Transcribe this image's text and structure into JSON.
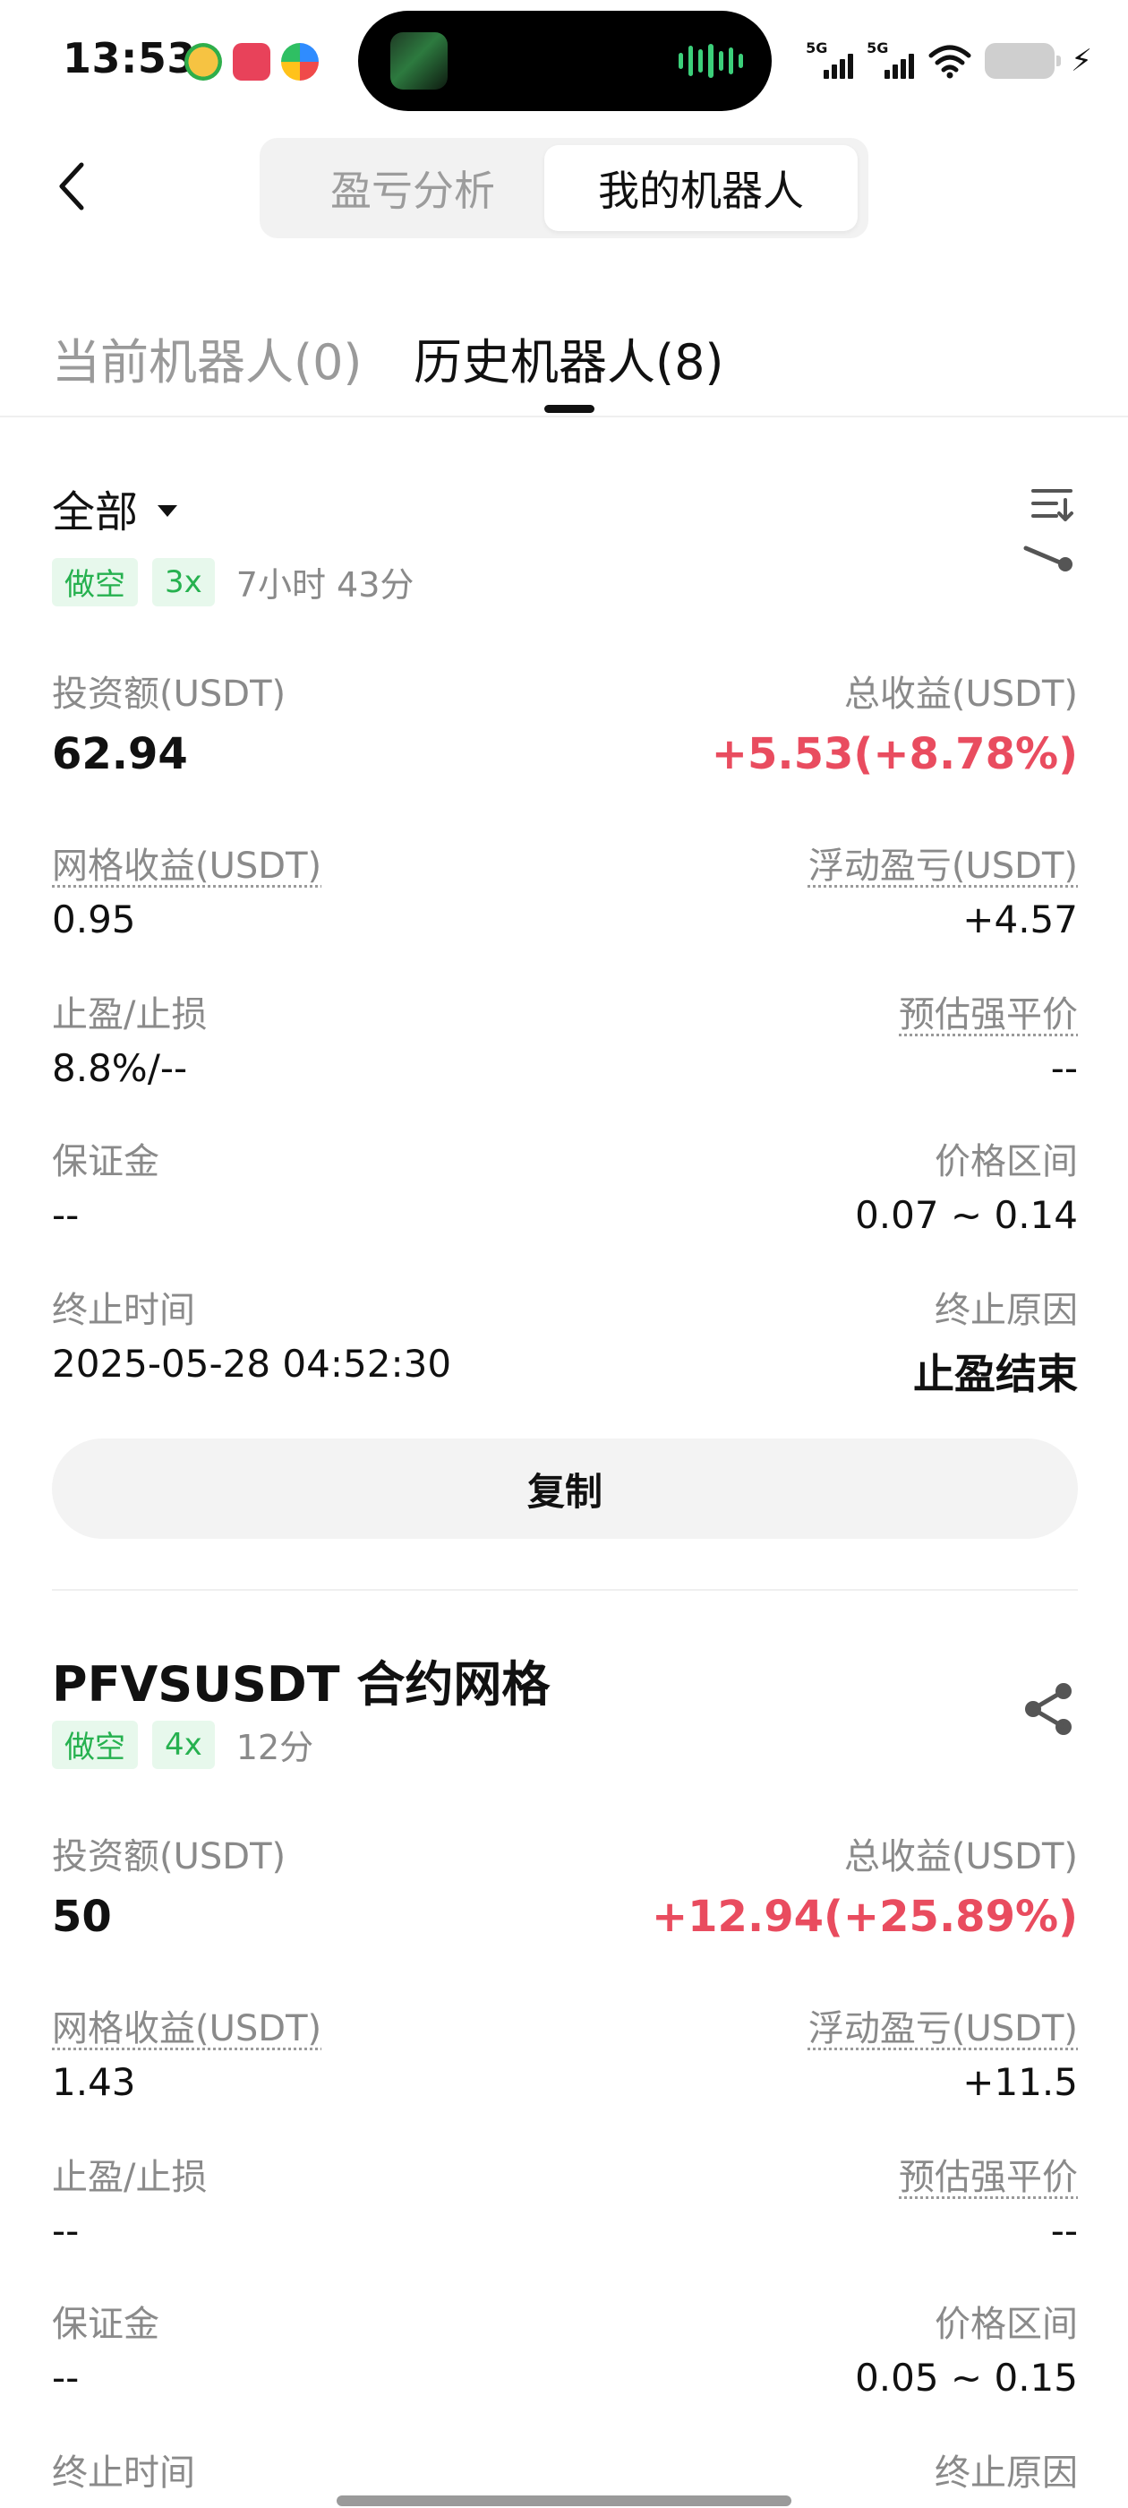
{
  "status_bar": {
    "time": "13:53",
    "signal_1_label": "5G",
    "signal_2_label": "5G"
  },
  "header": {
    "segments": [
      "盈亏分析",
      "我的机器人"
    ],
    "active_segment": "我的机器人"
  },
  "tabs": [
    {
      "label": "当前机器人(0)",
      "active": false
    },
    {
      "label": "历史机器人(8)",
      "active": true
    }
  ],
  "filter": {
    "label": "全部"
  },
  "colors": {
    "positive": "#e94c5f",
    "badge_text": "#26b14f",
    "badge_bg": "#e7f8ec"
  },
  "cards": [
    {
      "title": "",
      "badges": [
        "做空",
        "3x"
      ],
      "duration": "7小时 43分",
      "investment_label": "投资额(USDT)",
      "investment": "62.94",
      "total_profit_label": "总收益(USDT)",
      "total_profit": "+5.53(+8.78%)",
      "grid_profit_label": "网格收益(USDT)",
      "grid_profit": "0.95",
      "floating_pnl_label": "浮动盈亏(USDT)",
      "floating_pnl": "+4.57",
      "tp_sl_label": "止盈/止损",
      "tp_sl": "8.8%/--",
      "liq_price_label": "预估强平价",
      "liq_price": "--",
      "margin_label": "保证金",
      "margin": "--",
      "price_range_label": "价格区间",
      "price_range": "0.07 ~ 0.14",
      "end_time_label": "终止时间",
      "end_time": "2025-05-28 04:52:30",
      "end_reason_label": "终止原因",
      "end_reason": "止盈结束",
      "copy_label": "复制"
    },
    {
      "title": "PFVSUSDT 合约网格",
      "badges": [
        "做空",
        "4x"
      ],
      "duration": "12分",
      "investment_label": "投资额(USDT)",
      "investment": "50",
      "total_profit_label": "总收益(USDT)",
      "total_profit": "+12.94(+25.89%)",
      "grid_profit_label": "网格收益(USDT)",
      "grid_profit": "1.43",
      "floating_pnl_label": "浮动盈亏(USDT)",
      "floating_pnl": "+11.5",
      "tp_sl_label": "止盈/止损",
      "tp_sl": "--",
      "liq_price_label": "预估强平价",
      "liq_price": "--",
      "margin_label": "保证金",
      "margin": "--",
      "price_range_label": "价格区间",
      "price_range": "0.05 ~ 0.15",
      "end_time_label": "终止时间",
      "end_reason_label": "终止原因"
    }
  ]
}
